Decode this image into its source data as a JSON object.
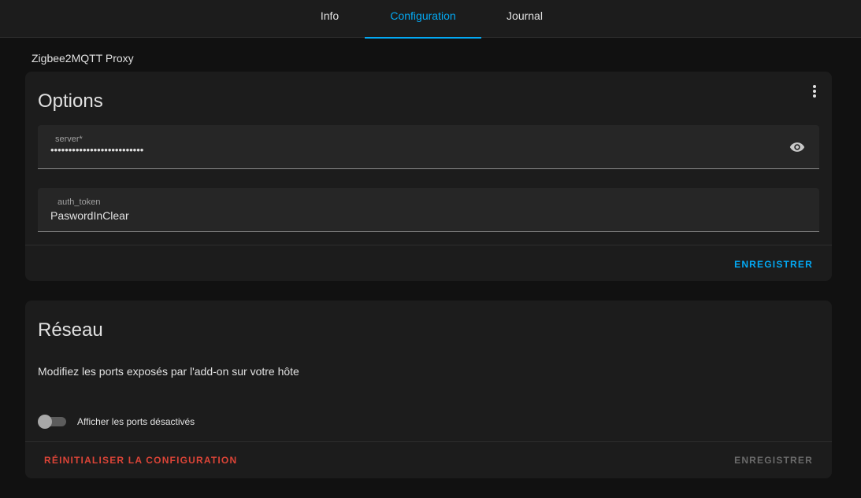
{
  "tabs": [
    {
      "label": "Info"
    },
    {
      "label": "Configuration"
    },
    {
      "label": "Journal"
    }
  ],
  "addon": {
    "name": "Zigbee2MQTT Proxy"
  },
  "options_card": {
    "title": "Options",
    "menu_icon": "more-vertical-icon",
    "server_field": {
      "label": "server*",
      "masked_value": "••••••••••••••••••••••••••",
      "toggle_icon": "eye-icon"
    },
    "auth_token_field": {
      "label": "auth_token",
      "value": "PaswordInClear"
    },
    "save_label": "ENREGISTRER"
  },
  "network_card": {
    "title": "Réseau",
    "description": "Modifiez les ports exposés par l'add-on sur votre hôte",
    "toggle_label": "Afficher les ports désactivés",
    "reset_label": "RÉINITIALISER LA CONFIGURATION",
    "save_label": "ENREGISTRER"
  },
  "colors": {
    "accent": "#03a9f4",
    "danger": "#db4437",
    "background": "#111111",
    "card": "#1c1c1c"
  }
}
